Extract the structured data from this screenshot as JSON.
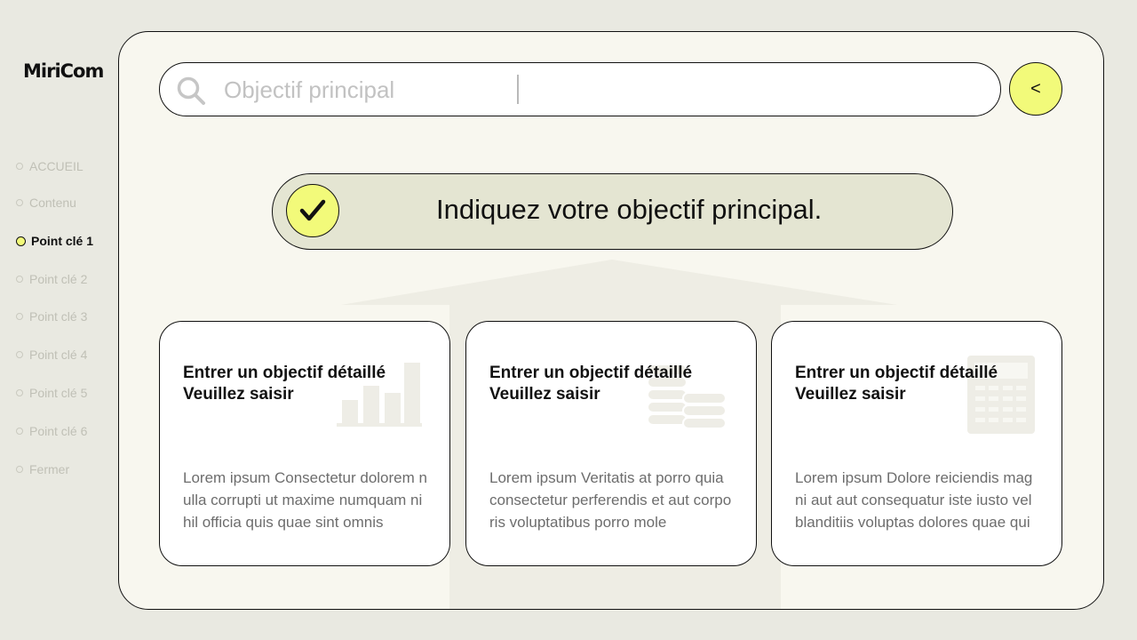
{
  "app": {
    "logo": "MiriCom"
  },
  "nav": {
    "items": [
      {
        "label": "ACCUEIL",
        "active": false
      },
      {
        "label": "Contenu",
        "active": false
      },
      {
        "label": "Point clé 1",
        "active": true
      },
      {
        "label": "Point clé 2",
        "active": false
      },
      {
        "label": "Point clé 3",
        "active": false
      },
      {
        "label": "Point clé 4",
        "active": false
      },
      {
        "label": "Point clé 5",
        "active": false
      },
      {
        "label": "Point clé 6",
        "active": false
      },
      {
        "label": "Fermer",
        "active": false
      }
    ]
  },
  "search": {
    "placeholder": "Objectif principal",
    "value": "",
    "icon": "search-icon"
  },
  "back_button": {
    "label": "<"
  },
  "banner": {
    "text": "Indiquez votre objectif principal.",
    "icon": "checkmark-icon"
  },
  "cards": [
    {
      "title_line1": "Entrer un objectif détaillé",
      "title_line2": "Veuillez saisir",
      "body": "Lorem ipsum Consectetur dolorem nulla corrupti ut maxime numquam nihil officia quis quae sint omnis",
      "icon": "bar-chart-icon"
    },
    {
      "title_line1": "Entrer un objectif détaillé",
      "title_line2": "Veuillez saisir",
      "body": "Lorem ipsum Veritatis at porro quia consectetur perferendis et aut corporis voluptatibus porro mole",
      "icon": "coins-icon"
    },
    {
      "title_line1": "Entrer un objectif détaillé",
      "title_line2": "Veuillez saisir",
      "body": "Lorem ipsum Dolore reiciendis magni aut aut consequatur iste iusto vel blanditiis voluptas dolores quae qui",
      "icon": "calculator-icon"
    }
  ],
  "colors": {
    "accent": "#f2fa7a",
    "background": "#e9e9e1",
    "panel": "#f8f7ef",
    "banner": "#e4e5d2"
  }
}
